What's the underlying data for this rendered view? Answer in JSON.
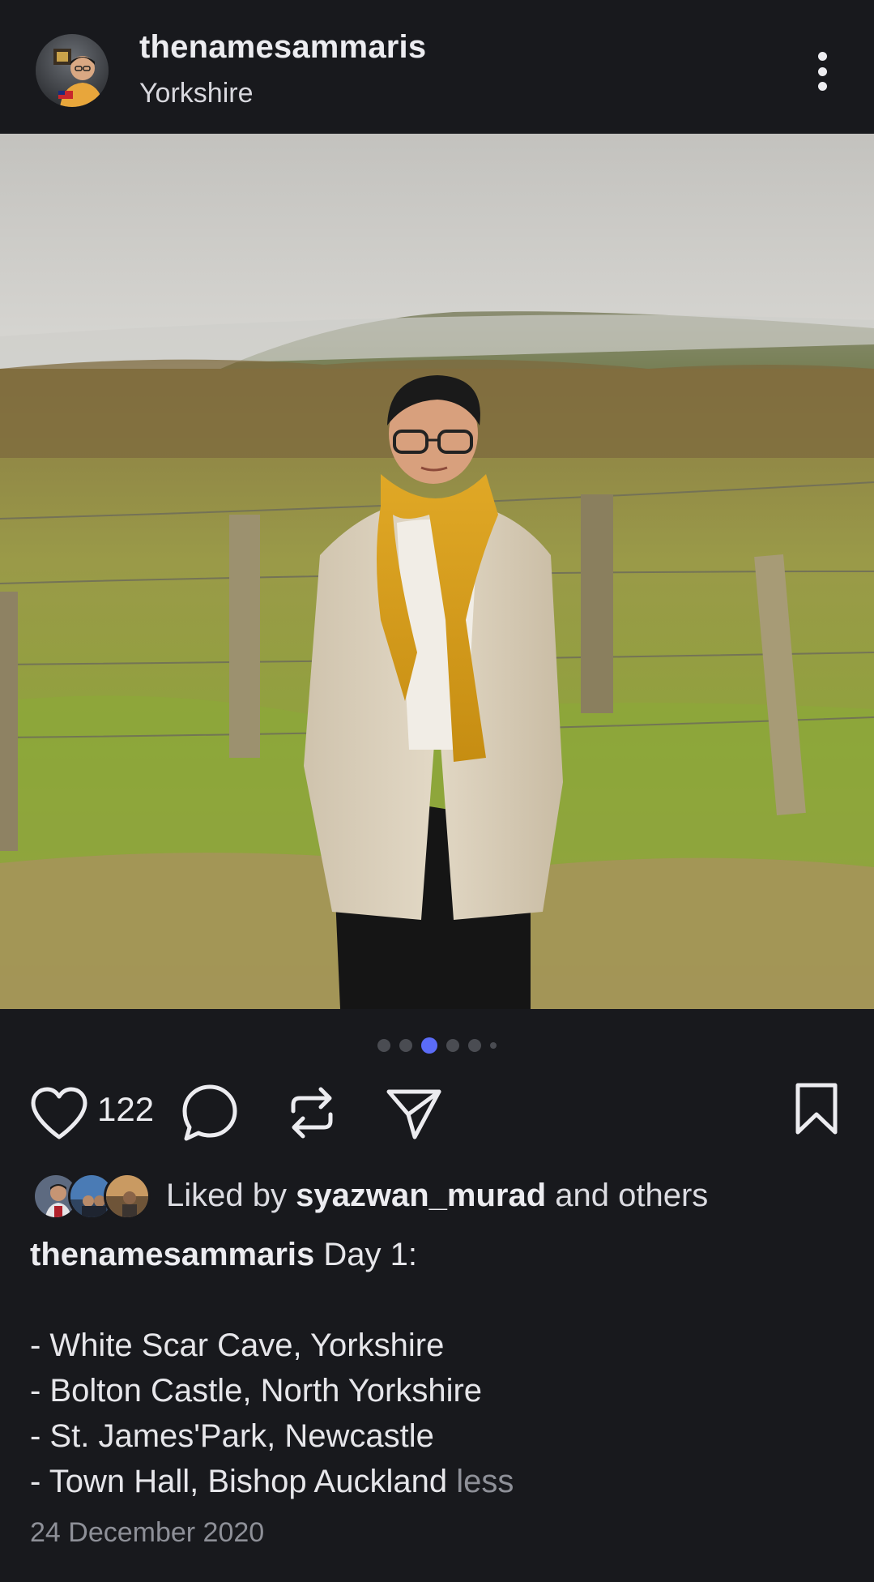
{
  "post": {
    "username": "thenamesammaris",
    "location": "Yorkshire",
    "like_count": "122",
    "liked_by_prefix": "Liked by",
    "liked_by_user": "syazwan_murad",
    "liked_by_suffix": "and others",
    "caption_user": "thenamesammaris",
    "caption_first": "Day 1:",
    "caption_lines": [
      "- White Scar Cave, Yorkshire",
      "- Bolton Castle, North Yorkshire",
      "- St. James'Park, Newcastle",
      "- Town Hall, Bishop Auckland"
    ],
    "less_label": "less",
    "date": "24 December 2020"
  },
  "carousel": {
    "total": 6,
    "active_index": 2
  },
  "icons": {
    "more": "more-vertical-icon",
    "like": "heart-icon",
    "comment": "comment-icon",
    "repost": "repost-icon",
    "share": "send-icon",
    "save": "bookmark-icon"
  },
  "colors": {
    "background": "#18191d",
    "accent": "#5b6cf7",
    "muted": "#8e9098"
  }
}
